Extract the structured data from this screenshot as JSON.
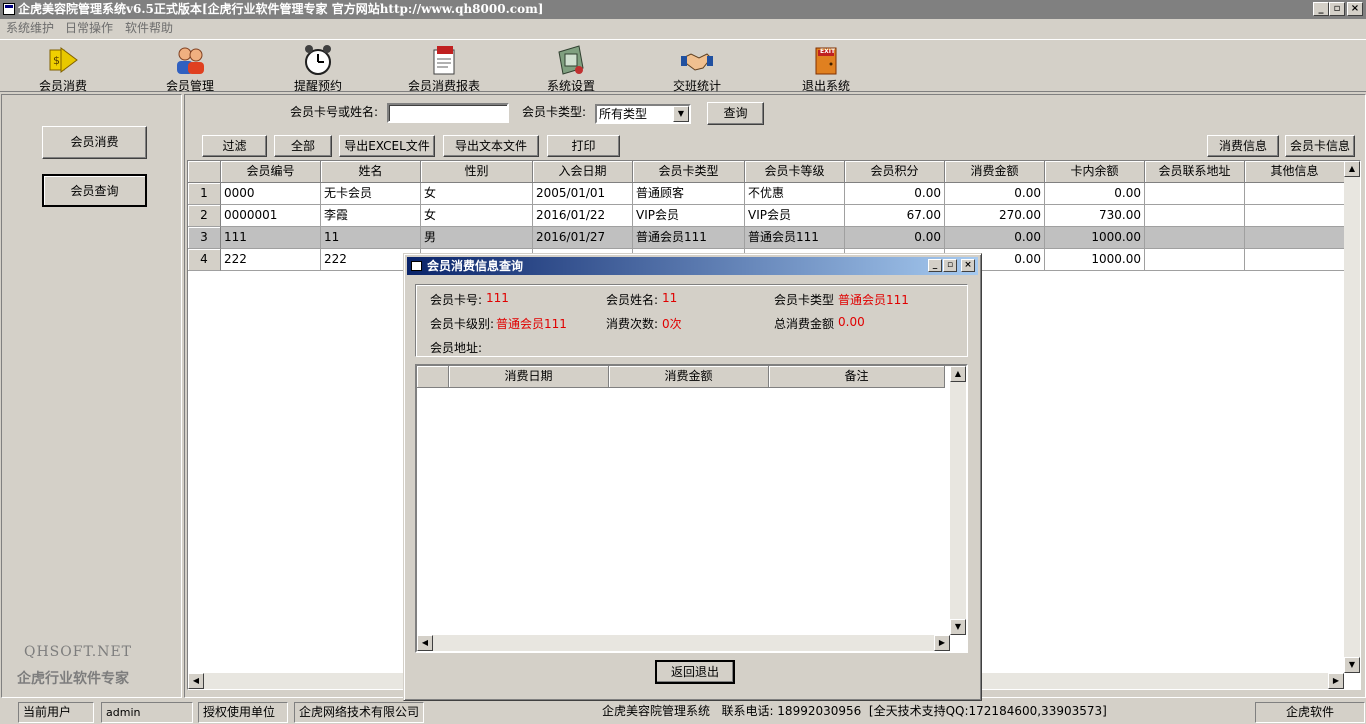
{
  "window": {
    "title": "企虎美容院管理系统v6.5正式版本[企虎行业软件管理专家 官方网站http://www.qh8000.com]",
    "min": "_",
    "max": "▫",
    "close": "×"
  },
  "menu": [
    "系统维护",
    "日常操作",
    "软件帮助"
  ],
  "toolbar": [
    {
      "label": "会员消费",
      "icon": "arrow-member-icon"
    },
    {
      "label": "会员管理",
      "icon": "users-icon"
    },
    {
      "label": "提醒预约",
      "icon": "alarm-clock-icon"
    },
    {
      "label": "会员消费报表",
      "icon": "report-icon"
    },
    {
      "label": "系统设置",
      "icon": "settings-icon"
    },
    {
      "label": "交班统计",
      "icon": "handshake-icon"
    },
    {
      "label": "退出系统",
      "icon": "exit-door-icon"
    }
  ],
  "exit_sign": "EXIT",
  "left": {
    "buttons": [
      "会员消费",
      "会员查询"
    ],
    "brand1": "QHSOFT.NET",
    "brand2": "企虎行业软件专家"
  },
  "search": {
    "label": "会员卡号或姓名:",
    "value": "",
    "type_label": "会员卡类型:",
    "type_value": "所有类型",
    "query_btn": "查询"
  },
  "actions": [
    "过滤",
    "全部",
    "导出EXCEL文件",
    "导出文本文件",
    "打印"
  ],
  "right_actions": [
    "消费信息",
    "会员卡信息"
  ],
  "grid": {
    "columns": [
      "",
      "会员编号",
      "姓名",
      "性别",
      "入会日期",
      "会员卡类型",
      "会员卡等级",
      "会员积分",
      "消费金额",
      "卡内余额",
      "会员联系地址",
      "其他信息"
    ],
    "rows": [
      [
        "1",
        "0000",
        "无卡会员",
        "女",
        "2005/01/01",
        "普通顾客",
        "不优惠",
        "0.00",
        "0.00",
        "0.00",
        "",
        ""
      ],
      [
        "2",
        "0000001",
        "李霞",
        "女",
        "2016/01/22",
        "VIP会员",
        "VIP会员",
        "67.00",
        "270.00",
        "730.00",
        "",
        ""
      ],
      [
        "3",
        "111",
        "11",
        "男",
        "2016/01/27",
        "普通会员111",
        "普通会员111",
        "0.00",
        "0.00",
        "1000.00",
        "",
        ""
      ],
      [
        "4",
        "222",
        "222",
        "男",
        "",
        "",
        "",
        "",
        "0.00",
        "1000.00",
        "",
        ""
      ]
    ]
  },
  "dialog": {
    "title": "会员消费信息查询",
    "card_no_label": "会员卡号:",
    "card_no": "111",
    "name_label": "会员姓名:",
    "name": "11",
    "type_label": "会员卡类型",
    "type": "普通会员111",
    "level_label": "会员卡级别:",
    "level": "普通会员111",
    "count_label": "消费次数:",
    "count": "0次",
    "total_label": "总消费金额",
    "total": "0.00",
    "address_label": "会员地址:",
    "address": "",
    "columns": [
      "",
      "消费日期",
      "消费金额",
      "备注"
    ],
    "return_btn": "返回退出"
  },
  "status": {
    "user_label": "当前用户",
    "user": "admin",
    "auth_label": "授权使用单位",
    "company": "企虎网络技术有限公司",
    "info": "企虎美容院管理系统   联系电话: 18992030956  [全天技术支持QQ:172184600,33903573]",
    "vendor": "企虎软件"
  }
}
